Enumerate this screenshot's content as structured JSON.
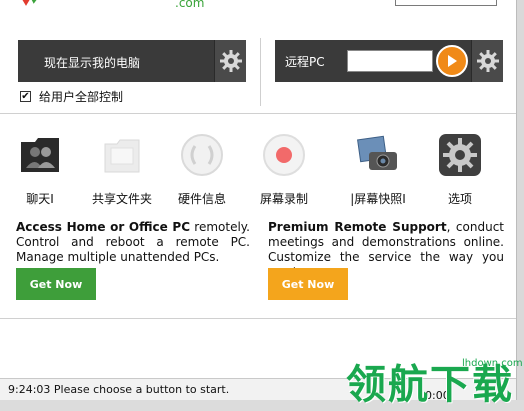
{
  "header": {
    "logo_domain": ".com"
  },
  "connect": {
    "my_computer_label": "现在显示我的电脑",
    "remote_label": "远程PC",
    "remote_input_value": "",
    "full_control_label": "给用户全部控制",
    "full_control_checked": true
  },
  "tools": [
    {
      "label": "聊天I",
      "icon": "chat-people-icon"
    },
    {
      "label": "共享文件夹",
      "icon": "shared-folder-icon"
    },
    {
      "label": "硬件信息",
      "icon": "hardware-info-icon"
    },
    {
      "label": "屏幕录制",
      "icon": "screen-record-icon"
    },
    {
      "label": "|屏幕快照I",
      "icon": "screenshot-camera-icon"
    },
    {
      "label": "选项",
      "icon": "options-gear-icon"
    }
  ],
  "promo_left": {
    "bold": "Access Home or Office PC",
    "text": " remotely. Control and reboot a remote PC. Manage multiple unattended PCs.",
    "button_label": "Get Now",
    "button_color": "#3e9e3a"
  },
  "promo_right": {
    "bold": "Premium Remote Support",
    "text": ", conduct meetings and demonstrations online. Customize the service the way you want.",
    "button_label": "Get Now",
    "button_color": "#f4a51c"
  },
  "status": {
    "message": "9:24:03 Please choose a button to start.",
    "time": "0:00"
  },
  "watermark": {
    "text": "领航下载",
    "url": "lhdown.com"
  },
  "colors": {
    "dark_bar": "#3a3a3a",
    "go_button": "#f08a18",
    "watermark": "#1aa84f"
  }
}
